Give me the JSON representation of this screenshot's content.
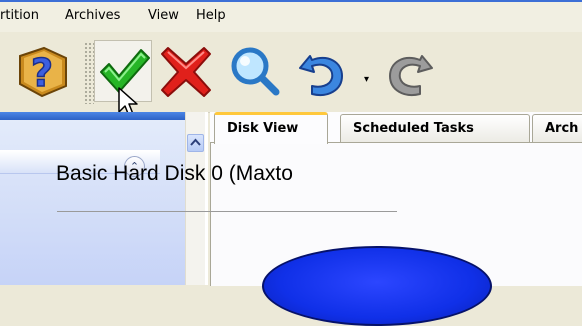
{
  "menubar": {
    "items": [
      "rtition",
      "Archives",
      "View",
      "Help"
    ]
  },
  "toolbar": {
    "buttons": [
      {
        "name": "help",
        "icon": "help-book-icon"
      },
      {
        "name": "apply",
        "icon": "green-checkmark-icon"
      },
      {
        "name": "cancel",
        "icon": "red-x-icon"
      },
      {
        "name": "search",
        "icon": "magnifier-icon"
      },
      {
        "name": "undo",
        "icon": "undo-arrow-icon"
      },
      {
        "name": "redo",
        "icon": "redo-arrow-icon"
      }
    ]
  },
  "tabs": [
    "Disk View",
    "Scheduled Tasks",
    "Arch"
  ],
  "active_tab": "Disk View",
  "disk_view": {
    "title": "Basic Hard Disk 0 (Maxto"
  },
  "colors": {
    "accent_blue": "#2d62c6",
    "tab_highlight": "#ffc83c",
    "apply_green": "#1fa51f",
    "cancel_red": "#e0201b",
    "disk_blue": "#1030e8"
  }
}
